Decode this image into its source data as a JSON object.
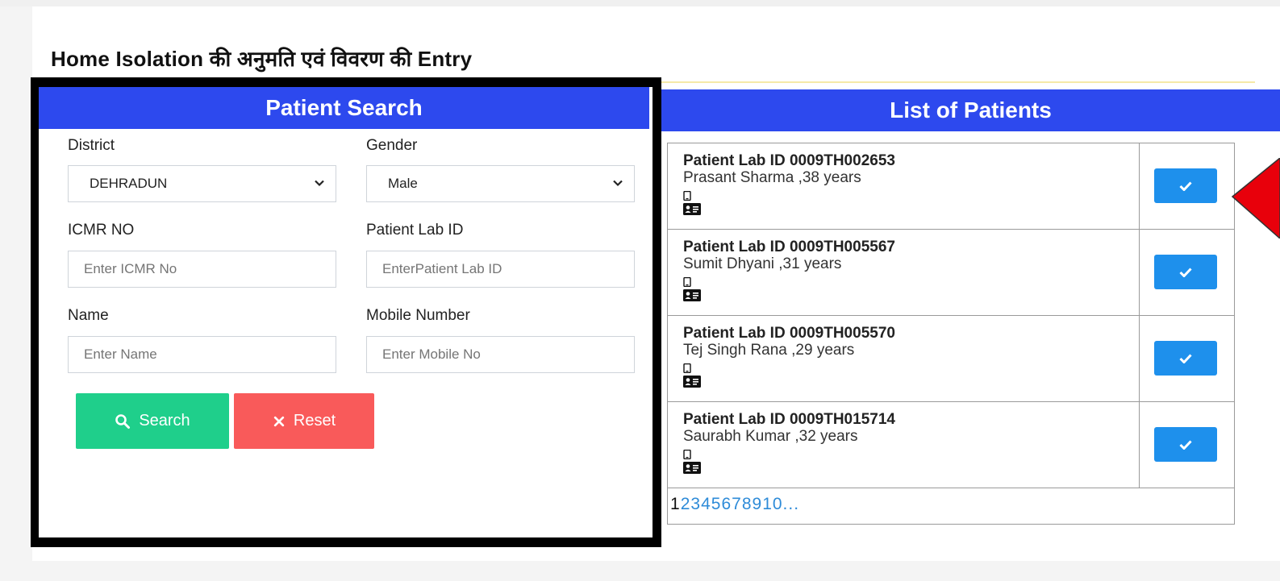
{
  "page": {
    "title": "Home Isolation की अनुमति एवं विवरण की Entry"
  },
  "search_panel": {
    "header": "Patient Search",
    "district": {
      "label": "District",
      "value": "DEHRADUN"
    },
    "gender": {
      "label": "Gender",
      "value": "Male"
    },
    "icmr": {
      "label": "ICMR NO",
      "placeholder": "Enter ICMR No"
    },
    "lab_id": {
      "label": "Patient Lab ID",
      "placeholder": "EnterPatient Lab ID"
    },
    "name": {
      "label": "Name",
      "placeholder": "Enter Name"
    },
    "mobile": {
      "label": "Mobile Number",
      "placeholder": "Enter Mobile No"
    },
    "search_button": "Search",
    "reset_button": "Reset"
  },
  "patients_panel": {
    "header": "List of Patients",
    "patients": [
      {
        "lab_id": "Patient Lab ID 0009TH002653",
        "name": "Prasant Sharma ,38 years"
      },
      {
        "lab_id": "Patient Lab ID 0009TH005567",
        "name": "Sumit Dhyani ,31 years"
      },
      {
        "lab_id": "Patient Lab ID 0009TH005570",
        "name": "Tej Singh Rana ,29 years"
      },
      {
        "lab_id": "Patient Lab ID 0009TH015714",
        "name": "Saurabh Kumar ,32 years"
      }
    ],
    "pagination": {
      "current": "1",
      "pages": [
        "2",
        "3",
        "4",
        "5",
        "6",
        "7",
        "8",
        "9",
        "10",
        "..."
      ]
    }
  },
  "colors": {
    "header_blue": "#2d49ee",
    "search_green": "#1fcf8b",
    "reset_red": "#f95a5a",
    "select_blue": "#1e90ec",
    "annotation_red": "#e8000b"
  },
  "icons": {
    "dropdown": "chevron-down-icon",
    "search": "magnifier-icon",
    "reset": "x-icon",
    "select": "check-icon",
    "mobile": "mobile-phone-icon",
    "id_card": "id-card-icon"
  }
}
